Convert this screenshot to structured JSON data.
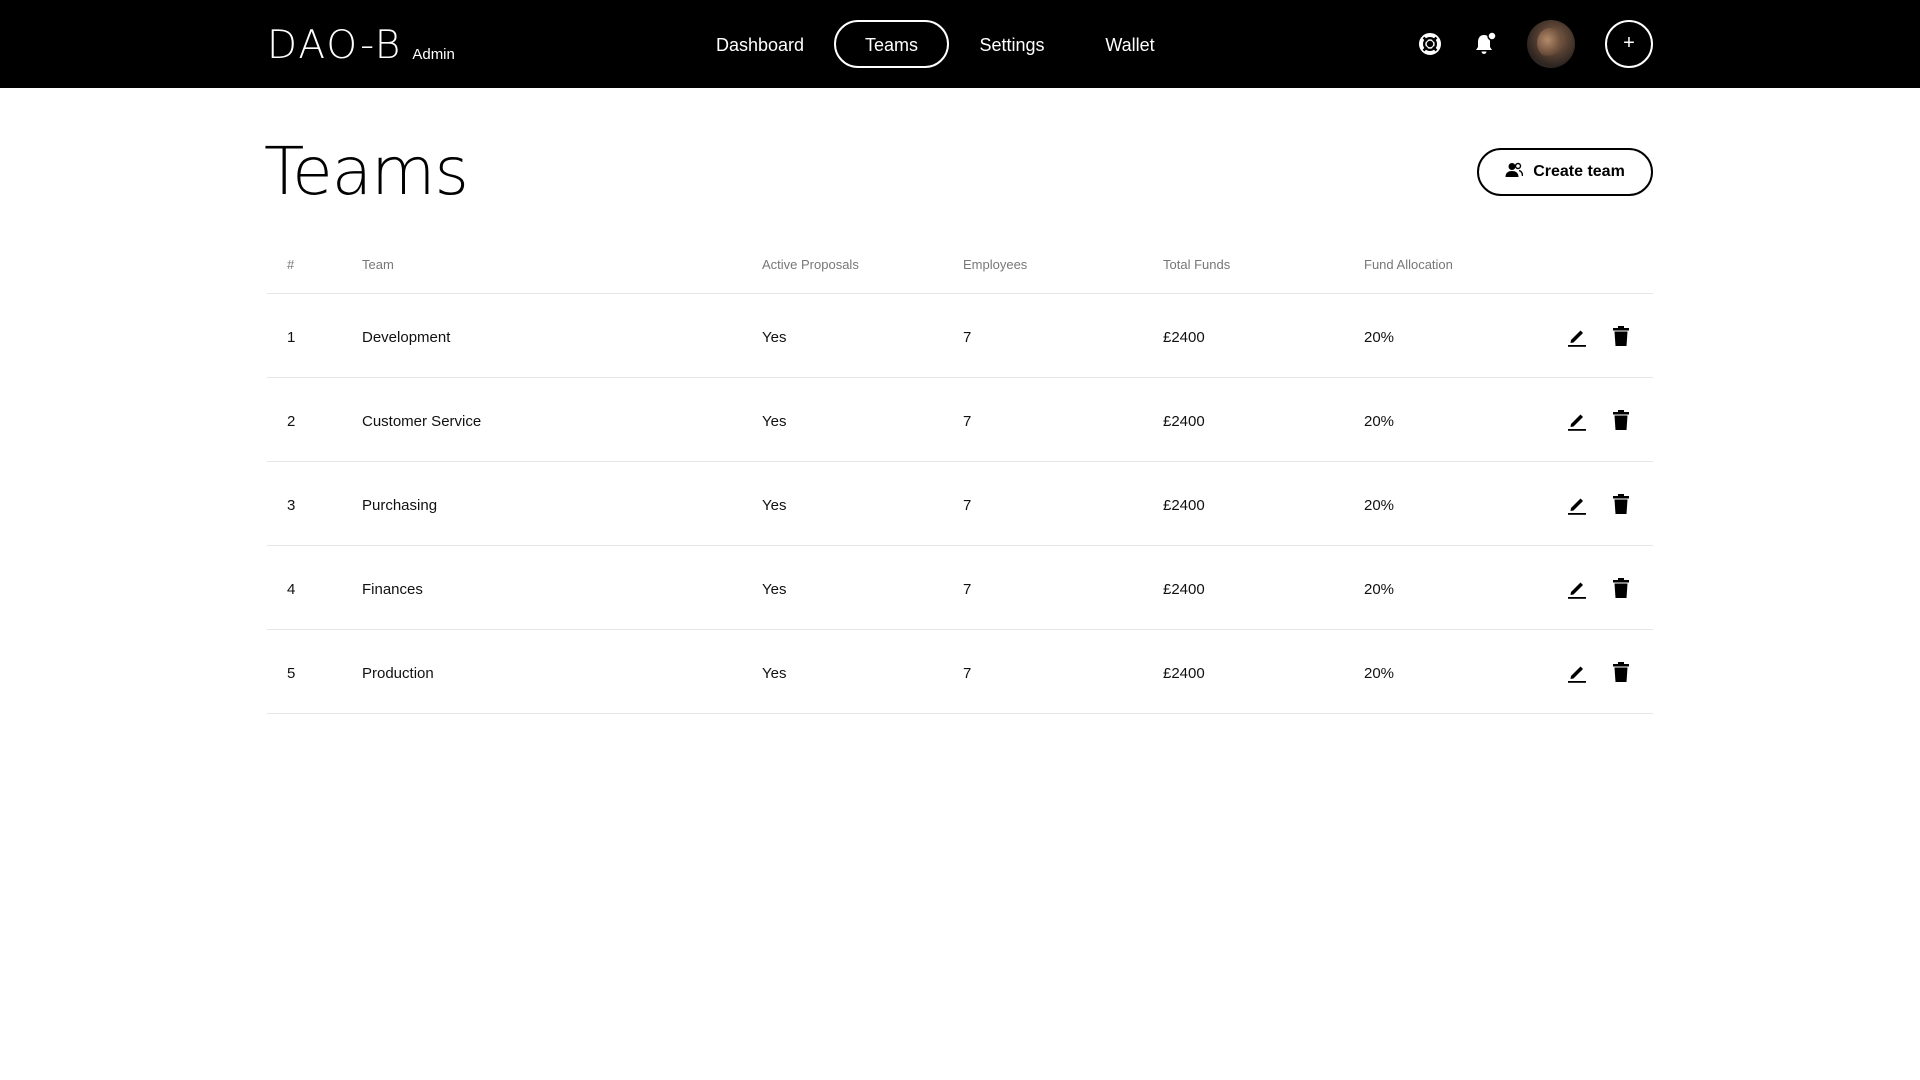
{
  "header": {
    "logo": "DAO-B",
    "role": "Admin",
    "nav": [
      {
        "label": "Dashboard",
        "active": false
      },
      {
        "label": "Teams",
        "active": true
      },
      {
        "label": "Settings",
        "active": false
      },
      {
        "label": "Wallet",
        "active": false
      }
    ],
    "icons": [
      "lifebuoy-icon",
      "bell-icon",
      "avatar",
      "plus-icon"
    ],
    "add_label": "+"
  },
  "page": {
    "title": "Teams",
    "create_button": "Create team"
  },
  "table": {
    "columns": [
      "#",
      "Team",
      "Active Proposals",
      "Employees",
      "Total Funds",
      "Fund Allocation"
    ],
    "rows": [
      {
        "num": "1",
        "team": "Development",
        "proposals": "Yes",
        "employees": "7",
        "funds": "£2400",
        "allocation": "20%"
      },
      {
        "num": "2",
        "team": "Customer Service",
        "proposals": "Yes",
        "employees": "7",
        "funds": "£2400",
        "allocation": "20%"
      },
      {
        "num": "3",
        "team": "Purchasing",
        "proposals": "Yes",
        "employees": "7",
        "funds": "£2400",
        "allocation": "20%"
      },
      {
        "num": "4",
        "team": "Finances",
        "proposals": "Yes",
        "employees": "7",
        "funds": "£2400",
        "allocation": "20%"
      },
      {
        "num": "5",
        "team": "Production",
        "proposals": "Yes",
        "employees": "7",
        "funds": "£2400",
        "allocation": "20%"
      }
    ]
  },
  "colors": {
    "header_bg": "#000000",
    "page_bg": "#ffffff",
    "divider": "#e6e6e6",
    "muted_text": "#777777"
  }
}
